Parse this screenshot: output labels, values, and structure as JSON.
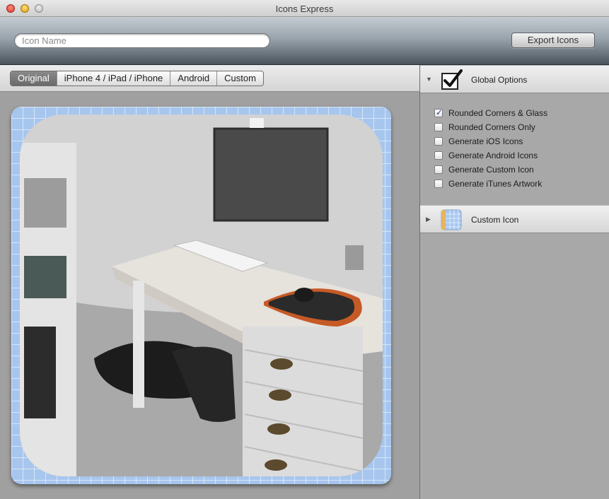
{
  "window": {
    "title": "Icons Express"
  },
  "toolbar": {
    "search_placeholder": "Icon Name",
    "export_label": "Export Icons"
  },
  "tabs": [
    {
      "label": "Original",
      "active": true
    },
    {
      "label": "iPhone 4 / iPad / iPhone",
      "active": false
    },
    {
      "label": "Android",
      "active": false
    },
    {
      "label": "Custom",
      "active": false
    }
  ],
  "preview": {
    "grid_color": "#a7c6ee"
  },
  "global_options": {
    "title": "Global Options",
    "expanded": true,
    "icon": "checkmark-icon",
    "options": [
      {
        "label": "Rounded Corners & Glass",
        "checked": true
      },
      {
        "label": "Rounded Corners Only",
        "checked": false
      },
      {
        "label": "Generate iOS Icons",
        "checked": false
      },
      {
        "label": "Generate Android Icons",
        "checked": false
      },
      {
        "label": "Generate Custom Icon",
        "checked": false
      },
      {
        "label": "Generate iTunes Artwork",
        "checked": false
      }
    ]
  },
  "custom_icon": {
    "title": "Custom Icon",
    "expanded": false,
    "icon": "grid-document-icon"
  }
}
